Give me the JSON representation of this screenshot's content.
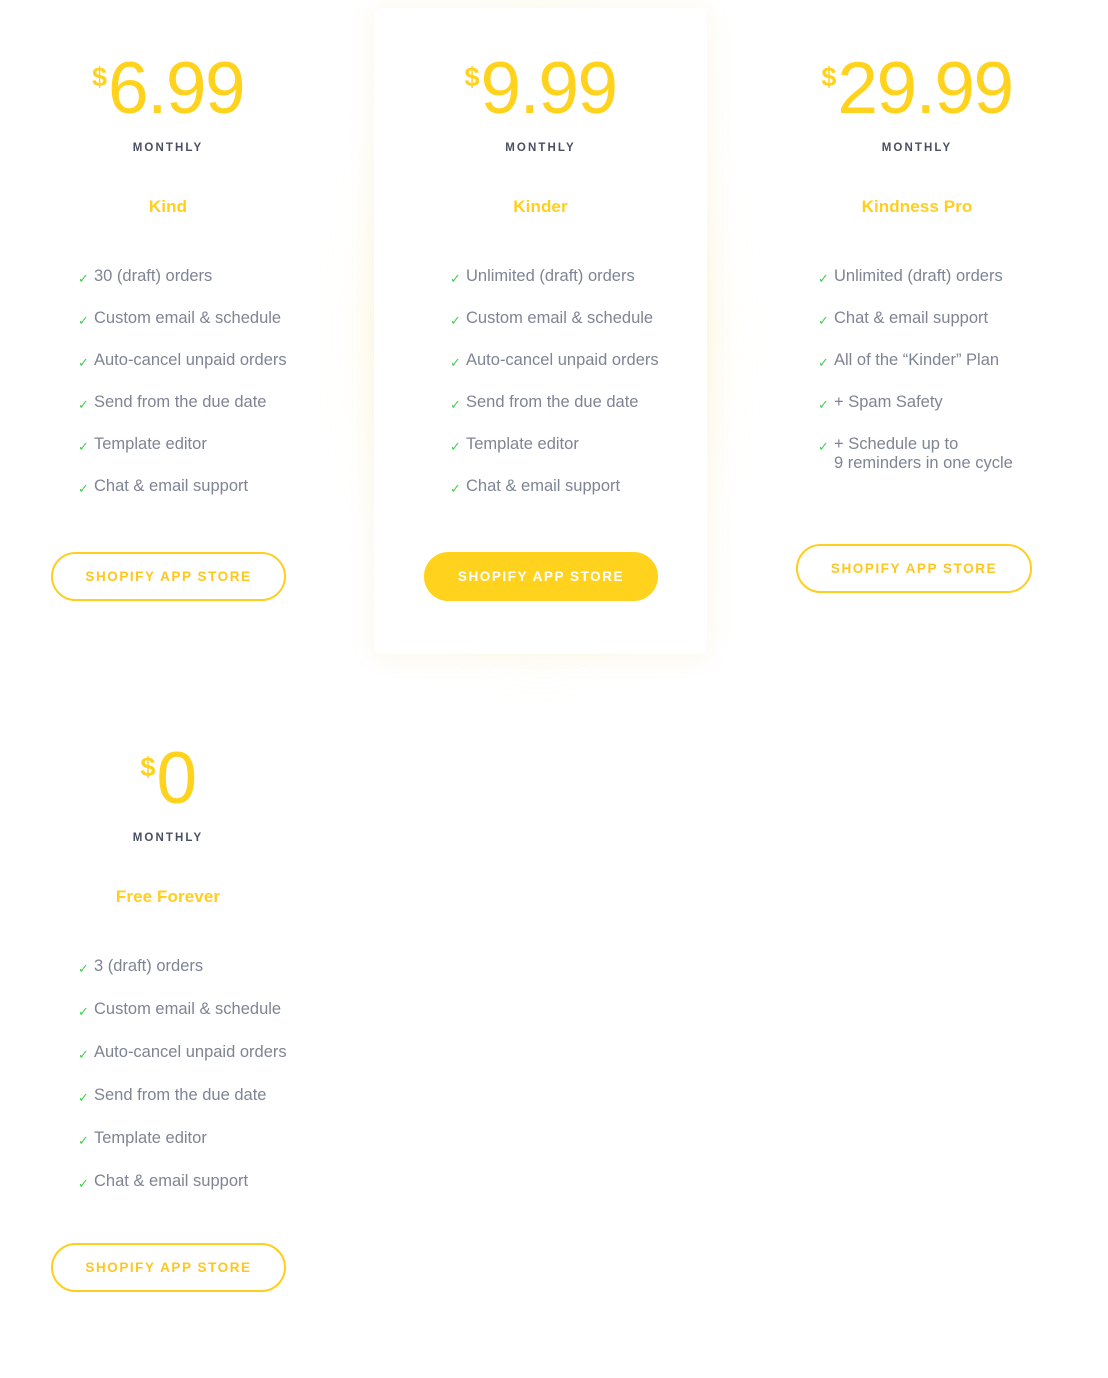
{
  "plans": [
    {
      "id": "kind",
      "currency": "$",
      "amount": "6.99",
      "period": "MONTHLY",
      "name": "Kind",
      "features": [
        "30 (draft) orders",
        "Custom email & schedule",
        "Auto-cancel unpaid orders",
        "Send from the due date",
        "Template editor",
        "Chat & email support"
      ],
      "cta": "SHOPIFY APP STORE",
      "featured": false
    },
    {
      "id": "kinder",
      "currency": "$",
      "amount": "9.99",
      "period": "MONTHLY",
      "name": "Kinder",
      "features": [
        "Unlimited (draft) orders",
        "Custom email & schedule",
        "Auto-cancel unpaid orders",
        "Send from the due date",
        "Template editor",
        "Chat & email support"
      ],
      "cta": "SHOPIFY APP STORE",
      "featured": true
    },
    {
      "id": "pro",
      "currency": "$",
      "amount": "29.99",
      "period": "MONTHLY",
      "name": "Kindness Pro",
      "features": [
        "Unlimited (draft) orders",
        "Chat & email support",
        "All of the “Kinder” Plan",
        "+ Spam Safety",
        "+ Schedule up to"
      ],
      "feature_last_extra_line": "9 reminders in one cycle",
      "cta": "SHOPIFY APP STORE",
      "featured": false
    },
    {
      "id": "free",
      "currency": "$",
      "amount": "0",
      "period": "MONTHLY",
      "name": "Free Forever",
      "features": [
        "3 (draft) orders",
        "Custom email & schedule",
        "Auto-cancel unpaid orders",
        "Send from the due date",
        "Template editor",
        "Chat & email support"
      ],
      "cta": "SHOPIFY APP STORE",
      "featured": false
    }
  ],
  "icons": {
    "check": "✓"
  },
  "colors": {
    "accent_yellow": "#FFD21E",
    "plan_title_yellow": "#FFCE1E",
    "check_green": "#3ED14B",
    "feature_text_gray": "#7F8494",
    "period_label_gray": "#4A4F63",
    "page_background": "#FFFFFF",
    "featured_card_background": "#FFFFFF"
  }
}
